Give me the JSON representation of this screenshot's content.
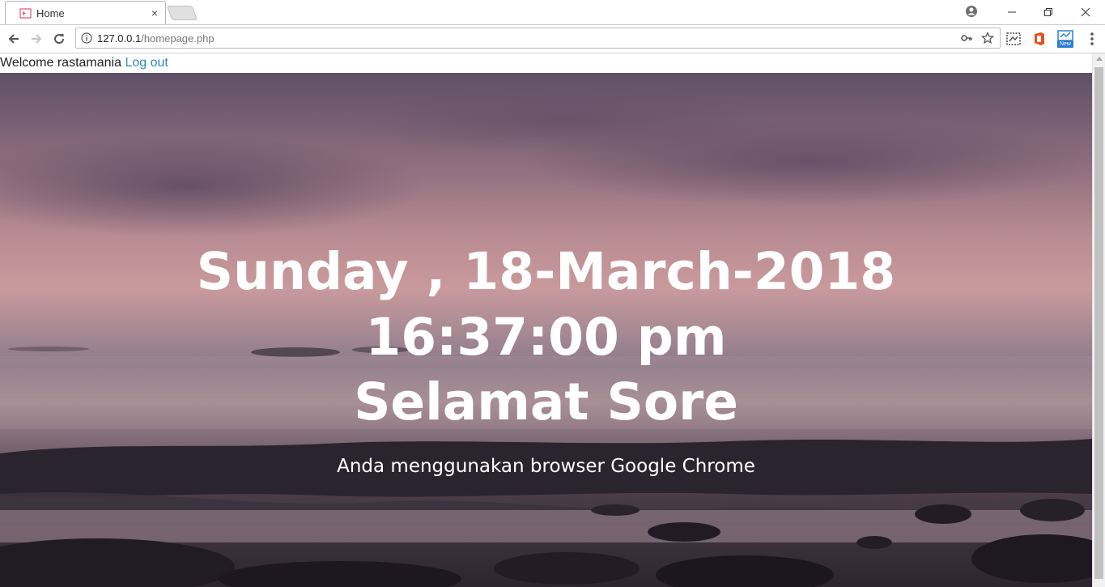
{
  "browser": {
    "tab": {
      "title": "Home",
      "close_glyph": "×"
    },
    "window": {
      "minimize_glyph": "–",
      "restore_glyph": "❐",
      "close_glyph": "✕"
    },
    "address": {
      "host": "127.0.0.1",
      "path": "/homepage.php"
    },
    "extensions": {
      "new_badge": "New"
    }
  },
  "page": {
    "welcome_text": "Welcome rastamania",
    "logout_label": "Log out",
    "date_text": "Sunday , 18-March-2018",
    "time_text": "16:37:00 pm",
    "greeting_text": "Selamat Sore",
    "browser_message": "Anda menggunakan browser Google Chrome"
  },
  "colors": {
    "link": "#2a8bc1",
    "hero_text": "#ffffff"
  }
}
